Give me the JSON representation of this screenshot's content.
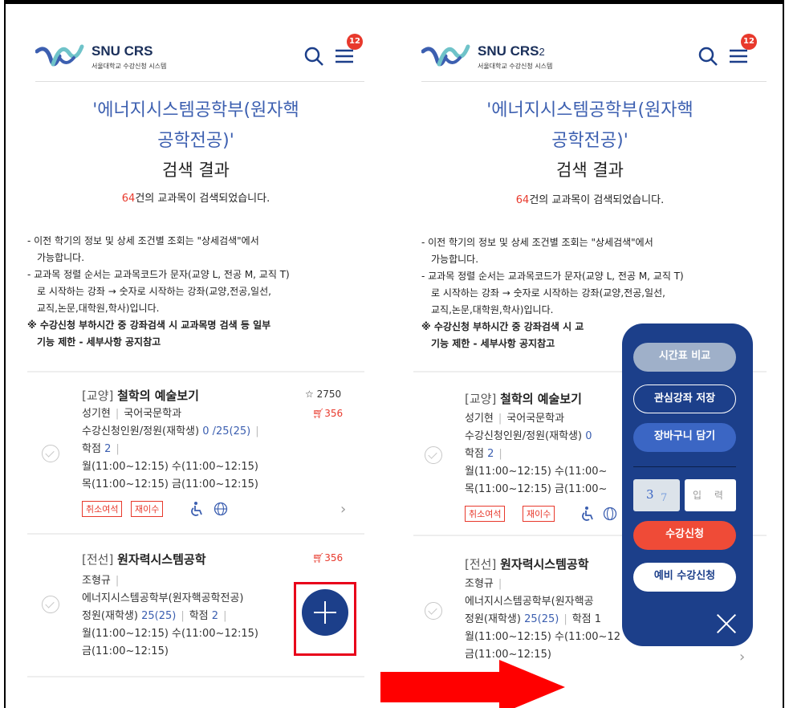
{
  "left": {
    "header": {
      "logo_title": "SNU CRS",
      "logo_sup": "",
      "logo_sub": "서울대학교 수강신청 시스템",
      "badge": "12"
    },
    "title1": "'에너지시스템공학부(원자핵",
    "title2": "공학전공)'",
    "subtitle": "검색 결과",
    "count_num": "64",
    "count_text": "건의 교과목이 검색되었습니다.",
    "notes": [
      "- 이전 학기의 정보 및 상세 조건별 조회는 \"상세검색\"에서",
      "가능합니다.",
      "- 교과목 정렬 순서는 교과목코드가 문자(교양 L, 전공 M, 교직 T)",
      "로 시작하는 강좌 → 숫자로 시작하는 강좌(교양,전공,일선,",
      "교직,논문,대학원,학사)입니다.",
      "※ 수강신청 부하시간 중 강좌검색 시 교과목명 검색 등 일부",
      "기능 제한 - 세부사항 공지참고"
    ],
    "course1": {
      "cat": "[교양]",
      "name": "철학의 예술보기",
      "star": "2750",
      "cart": "356",
      "prof": "성기현",
      "dept": "국어국문학과",
      "enroll_label": "수강신청인원/정원(재학생)",
      "enroll": "0 /25(25)",
      "credit_label": "학점",
      "credit": "2",
      "time1": "월(11:00~12:15) 수(11:00~12:15)",
      "time2": "목(11:00~12:15) 금(11:00~12:15)",
      "tag1": "취소여석",
      "tag2": "재이수"
    },
    "course2": {
      "cat": "[전선]",
      "name": "원자력시스템공학",
      "cart": "356",
      "prof": "조형규",
      "dept": "에너지시스템공학부(원자핵공학전공)",
      "quota_label": "정원(재학생)",
      "quota": "25(25)",
      "credit_label": "학점",
      "credit": "2",
      "time1": "월(11:00~12:15) 수(11:00~12:15)",
      "time2": "금(11:00~12:15)"
    }
  },
  "right": {
    "header": {
      "logo_title": "SNU CRS",
      "logo_sup": "2",
      "logo_sub": "서울대학교 수강신청 시스템",
      "badge": "12"
    },
    "title1": "'에너지시스템공학부(원자핵",
    "title2": "공학전공)'",
    "subtitle": "검색 결과",
    "count_num": "64",
    "count_text": "건의 교과목이 검색되었습니다.",
    "notes": [
      "- 이전 학기의 정보 및 상세 조건별 조회는 \"상세검색\"에서",
      "가능합니다.",
      "- 교과목 정렬 순서는 교과목코드가 문자(교양 L, 전공 M, 교직 T)",
      "로 시작하는 강좌 → 숫자로 시작하는 강좌(교양,전공,일선,",
      "교직,논문,대학원,학사)입니다.",
      "※ 수강신청 부하시간 중 강좌검색 시 교",
      "기능 제한 - 세부사항 공지참고"
    ],
    "course1": {
      "cat": "[교양]",
      "name": "철학의 예술보기",
      "prof": "성기현",
      "dept": "국어국문학과",
      "enroll_label": "수강신청인원/정원(재학생)",
      "enroll": "0",
      "credit_label": "학점",
      "credit": "2",
      "time1": "월(11:00~12:15) 수(11:00~",
      "time2": "목(11:00~12:15) 금(11:00~",
      "tag1": "취소여석",
      "tag2": "재이수"
    },
    "course2": {
      "cat": "[전선]",
      "name": "원자력시스템공학",
      "prof": "조형규",
      "dept": "에너지시스템공학부(원자핵공",
      "quota_label": "정원(재학생)",
      "quota": "25(25)",
      "credit_label": "학점",
      "credit": "1",
      "time1": "월(11:00~12:15) 수(11:00~12",
      "time2": "금(11:00~12:15)"
    },
    "popup": {
      "compare": "시간표 비교",
      "save_interest": "관심강좌 저장",
      "add_cart": "장바구니 담기",
      "captcha_a": "3",
      "captcha_b": "7",
      "input_placeholder": "입 력",
      "register": "수강신청",
      "pre_register": "예비 수강신청"
    }
  },
  "colors": {
    "accent_blue": "#3c5fb0",
    "navy": "#1c3f8a",
    "red": "#e8392c",
    "highlight_red": "#e8001a"
  }
}
